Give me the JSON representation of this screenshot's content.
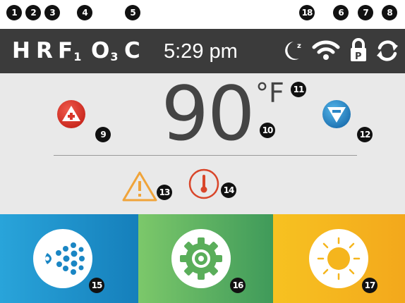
{
  "callouts": {
    "c1": "1",
    "c2": "2",
    "c3": "3",
    "c4": "4",
    "c5": "5",
    "c6": "6",
    "c7": "7",
    "c8": "8",
    "c9": "9",
    "c10": "10",
    "c11": "11",
    "c12": "12",
    "c13": "13",
    "c14": "14",
    "c15": "15",
    "c16": "16",
    "c17": "17",
    "c18": "18"
  },
  "status_bar": {
    "heater": "H",
    "ready": "R",
    "filter": "F",
    "filter_num": "1",
    "ozone": "O",
    "ozone_num": "3",
    "cleanup": "C",
    "time": "5:29 pm"
  },
  "temperature": {
    "value": "90",
    "unit": "°F"
  },
  "icons": {
    "sleep": "sleep-mode-icon",
    "wifi": "wifi-icon",
    "lock": "panel-lock-icon",
    "sync": "refresh-icon",
    "temp_up": "temp-up-icon",
    "temp_down": "temp-down-icon",
    "warning": "warning-icon",
    "thermometer": "thermometer-icon",
    "jets": "jets-icon",
    "settings": "settings-gear-icon",
    "light": "light-sun-icon"
  },
  "colors": {
    "status_bar_bg": "#3b3b3b",
    "up_red": "#e03a2f",
    "down_blue": "#2f8fcf",
    "warning_orange": "#f0a43a",
    "thermo_red": "#d9462a",
    "jets_blue": "#1a86c4",
    "settings_green": "#5aae5a",
    "light_yellow": "#f5b51d"
  }
}
